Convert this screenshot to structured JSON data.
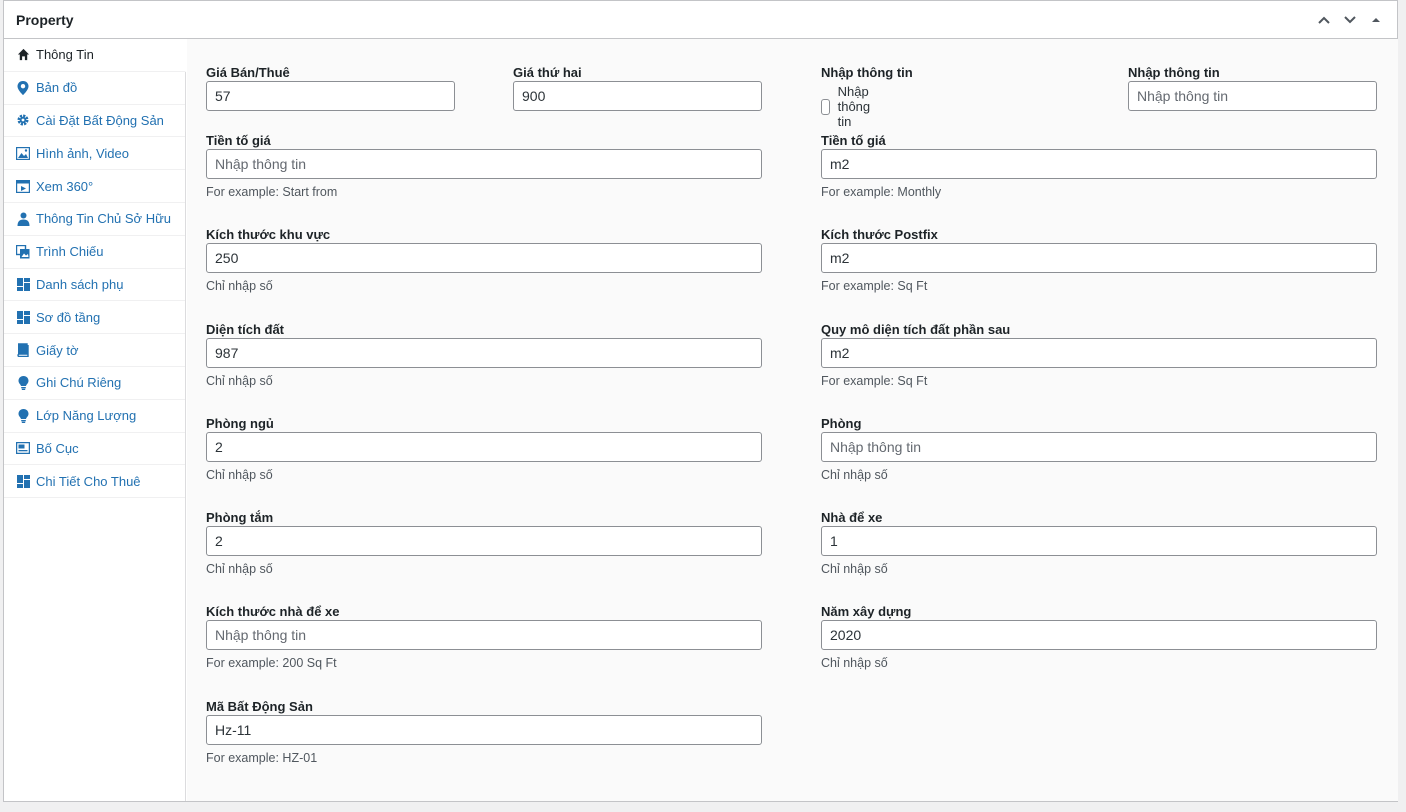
{
  "header": {
    "title": "Property"
  },
  "tabs": [
    {
      "label": "Thông Tin",
      "icon": "home-icon"
    },
    {
      "label": "Bản đồ",
      "icon": "map-pin-icon"
    },
    {
      "label": "Cài Đặt Bất Động Sản",
      "icon": "gear-icon"
    },
    {
      "label": "Hình ảnh, Video",
      "icon": "image-icon"
    },
    {
      "label": "Xem 360°",
      "icon": "video-icon"
    },
    {
      "label": "Thông Tin Chủ Sở Hữu",
      "icon": "user-icon"
    },
    {
      "label": "Trình Chiếu",
      "icon": "gallery-icon"
    },
    {
      "label": "Danh sách phụ",
      "icon": "grid-icon"
    },
    {
      "label": "Sơ đồ tầng",
      "icon": "grid-icon"
    },
    {
      "label": "Giấy tờ",
      "icon": "book-icon"
    },
    {
      "label": "Ghi Chú Riêng",
      "icon": "lightbulb-icon"
    },
    {
      "label": "Lớp Năng Lượng",
      "icon": "lightbulb-icon"
    },
    {
      "label": "Bố Cục",
      "icon": "layout-icon"
    },
    {
      "label": "Chi Tiết Cho Thuê",
      "icon": "grid-icon"
    }
  ],
  "form": {
    "price": {
      "label": "Giá Bán/Thuê",
      "value": "57"
    },
    "second_price": {
      "label": "Giá thứ hai",
      "value": "900"
    },
    "checkbox_field": {
      "label": "Nhập thông tin",
      "checkbox_label": "Nhập thông tin"
    },
    "text_field": {
      "label": "Nhập thông tin",
      "placeholder": "Nhập thông tin"
    },
    "price_prefix": {
      "label": "Tiền tố giá",
      "placeholder": "Nhập thông tin",
      "desc": "For example: Start from"
    },
    "price_postfix": {
      "label": "Tiền tố giá",
      "value": "m2",
      "desc": "For example: Monthly"
    },
    "area_size": {
      "label": "Kích thước khu vực",
      "value": "250",
      "desc": "Chỉ nhập số"
    },
    "size_postfix": {
      "label": "Kích thước Postfix",
      "value": "m2",
      "desc": "For example: Sq Ft"
    },
    "land_area": {
      "label": "Diện tích đất",
      "value": "987",
      "desc": "Chỉ nhập số"
    },
    "land_postfix": {
      "label": "Quy mô diện tích đất phần sau",
      "value": "m2",
      "desc": "For example: Sq Ft"
    },
    "bedrooms": {
      "label": "Phòng ngủ",
      "value": "2",
      "desc": "Chỉ nhập số"
    },
    "rooms": {
      "label": "Phòng",
      "placeholder": "Nhập thông tin",
      "desc": "Chỉ nhập số"
    },
    "bathrooms": {
      "label": "Phòng tắm",
      "value": "2",
      "desc": "Chỉ nhập số"
    },
    "garages": {
      "label": "Nhà để xe",
      "value": "1",
      "desc": "Chỉ nhập số"
    },
    "garage_size": {
      "label": "Kích thước nhà để xe",
      "placeholder": "Nhập thông tin",
      "desc": "For example: 200 Sq Ft"
    },
    "year_built": {
      "label": "Năm xây dựng",
      "value": "2020",
      "desc": "Chỉ nhập số"
    },
    "property_id": {
      "label": "Mã Bất Động Sản",
      "value": "Hz-11",
      "desc": "For example: HZ-01"
    }
  },
  "colors": {
    "link": "#2271b1",
    "border": "#c3c4c7",
    "input_border": "#8c8f94"
  }
}
